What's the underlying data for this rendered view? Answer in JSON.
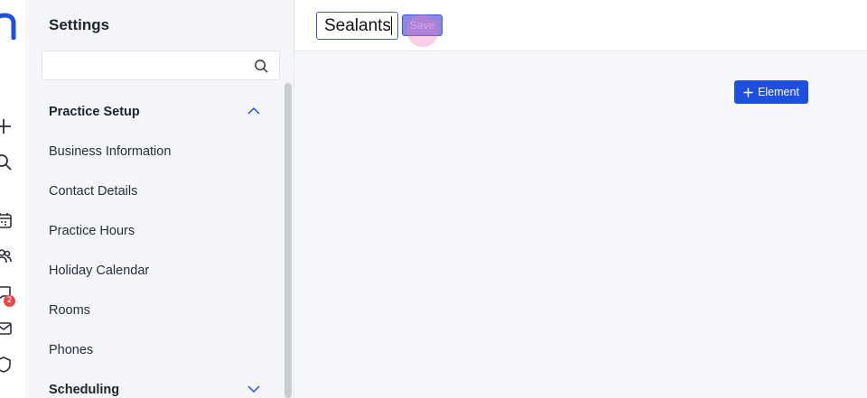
{
  "colors": {
    "accent": "#1f4fe0",
    "sidebar_bg": "#f4f5f8",
    "content_bg": "#f7f8fb",
    "badge": "#e5484d"
  },
  "rail": {
    "icons": [
      "logo-icon",
      "plus-icon",
      "search-icon",
      "calendar-icon",
      "people-icon",
      "chat-icon",
      "mail-icon",
      "shield-icon"
    ],
    "chat_badge_count": "2"
  },
  "sidebar": {
    "title": "Settings",
    "search": {
      "value": "",
      "placeholder": ""
    },
    "sections": [
      {
        "label": "Practice Setup",
        "expanded": true,
        "items": [
          {
            "label": "Business Information"
          },
          {
            "label": "Contact Details"
          },
          {
            "label": "Practice Hours"
          },
          {
            "label": "Holiday Calendar"
          },
          {
            "label": "Rooms"
          },
          {
            "label": "Phones"
          }
        ]
      },
      {
        "label": "Scheduling",
        "expanded": false,
        "items": []
      }
    ]
  },
  "editor": {
    "name_value": "Sealants",
    "save_label": "Save",
    "add_element_label": "Element"
  }
}
